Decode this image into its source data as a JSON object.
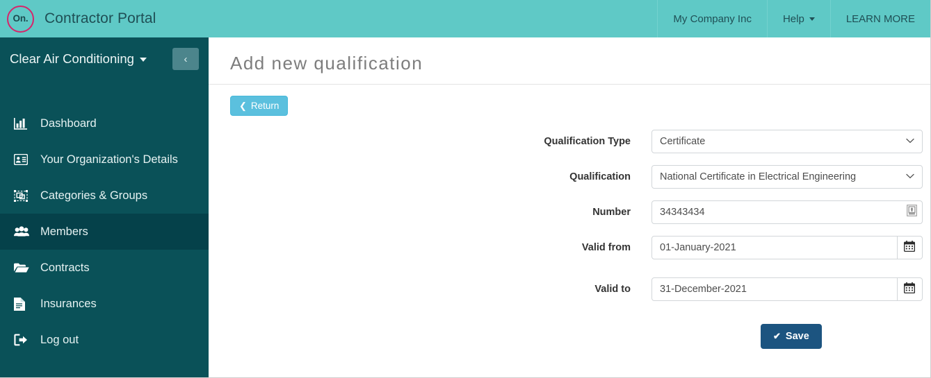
{
  "navbar": {
    "logo_text": "On.",
    "logo_icon": "brand-circle-icon",
    "brand_title": "Contractor Portal",
    "items": [
      {
        "label": "My Company Inc",
        "has_caret": false
      },
      {
        "label": "Help",
        "has_caret": true
      },
      {
        "label": "LEARN MORE",
        "has_caret": false
      }
    ]
  },
  "sidebar": {
    "org_name": "Clear Air Conditioning",
    "collapse_label": "‹",
    "items": [
      {
        "label": "Dashboard",
        "icon": "bar-chart-icon",
        "active": false
      },
      {
        "label": "Your Organization's Details",
        "icon": "id-card-icon",
        "active": false
      },
      {
        "label": "Categories & Groups",
        "icon": "object-group-icon",
        "active": false
      },
      {
        "label": "Members",
        "icon": "users-icon",
        "active": true
      },
      {
        "label": "Contracts",
        "icon": "folder-open-icon",
        "active": false
      },
      {
        "label": "Insurances",
        "icon": "file-text-icon",
        "active": false
      },
      {
        "label": "Log out",
        "icon": "sign-out-icon",
        "active": false
      }
    ]
  },
  "main": {
    "page_title": "Add new qualification",
    "return_button": "Return",
    "return_icon": "arrow-left-icon",
    "save_button": "Save",
    "save_icon": "check-icon",
    "fields": [
      {
        "label": "Qualification Type",
        "type": "select",
        "value": "Certificate",
        "options": [
          "Certificate"
        ]
      },
      {
        "label": "Qualification",
        "type": "select",
        "value": "National Certificate in Electrical Engineering",
        "options": [
          "National Certificate in Electrical Engineering"
        ]
      },
      {
        "label": "Number",
        "type": "text",
        "value": "34343434",
        "inner_icon": "form-autofill-icon"
      },
      {
        "label": "Valid from",
        "type": "date",
        "value": "01-January-2021",
        "addon_icon": "calendar-icon"
      },
      {
        "label": "Valid to",
        "type": "date",
        "value": "31-December-2021",
        "addon_icon": "calendar-icon"
      }
    ]
  },
  "colors": {
    "navbar_teal": "#5fc9c6",
    "sidebar_teal": "#0a5158",
    "sidebar_active": "#05414a",
    "brand_pink": "#d6256b",
    "return_blue": "#5bc0de",
    "save_blue": "#1c5480"
  }
}
